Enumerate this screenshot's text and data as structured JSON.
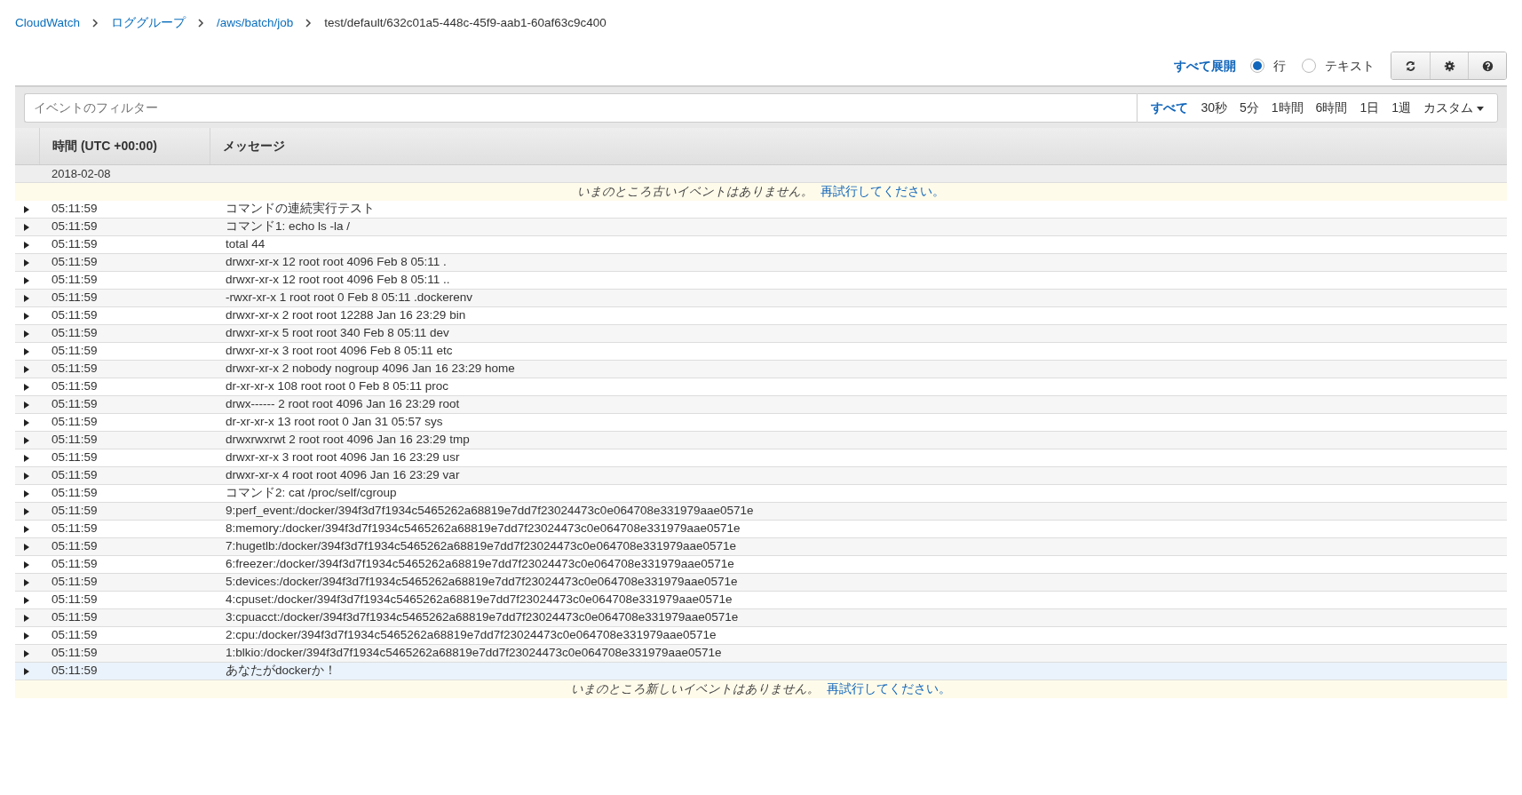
{
  "breadcrumb": [
    {
      "label": "CloudWatch",
      "link": true
    },
    {
      "label": "ロググループ",
      "link": true
    },
    {
      "label": "/aws/batch/job",
      "link": true
    },
    {
      "label": "test/default/632c01a5-448c-45f9-aab1-60af63c9c400",
      "link": false
    }
  ],
  "toolbar": {
    "expand_all": "すべて展開",
    "view_modes": [
      {
        "label": "行",
        "selected": true
      },
      {
        "label": "テキスト",
        "selected": false
      }
    ]
  },
  "filter": {
    "placeholder": "イベントのフィルター",
    "ranges": [
      {
        "label": "すべて",
        "selected": true
      },
      {
        "label": "30秒",
        "selected": false
      },
      {
        "label": "5分",
        "selected": false
      },
      {
        "label": "1時間",
        "selected": false
      },
      {
        "label": "6時間",
        "selected": false
      },
      {
        "label": "1日",
        "selected": false
      },
      {
        "label": "1週",
        "selected": false
      },
      {
        "label": "カスタム",
        "selected": false
      }
    ]
  },
  "table": {
    "columns": [
      "時間 (UTC +00:00)",
      "メッセージ"
    ],
    "date": "2018-02-08",
    "top_notice": {
      "text": "いまのところ古いイベントはありません。",
      "link": "再試行してください。"
    },
    "rows": [
      {
        "time": "05:11:59",
        "message": "コマンドの連続実行テスト",
        "selected": false
      },
      {
        "time": "05:11:59",
        "message": "コマンド1: echo ls -la /",
        "selected": false
      },
      {
        "time": "05:11:59",
        "message": "total 44",
        "selected": false
      },
      {
        "time": "05:11:59",
        "message": "drwxr-xr-x 12 root root 4096 Feb 8 05:11 .",
        "selected": false
      },
      {
        "time": "05:11:59",
        "message": "drwxr-xr-x 12 root root 4096 Feb 8 05:11 ..",
        "selected": false
      },
      {
        "time": "05:11:59",
        "message": "-rwxr-xr-x 1 root root 0 Feb 8 05:11 .dockerenv",
        "selected": false
      },
      {
        "time": "05:11:59",
        "message": "drwxr-xr-x 2 root root 12288 Jan 16 23:29 bin",
        "selected": false
      },
      {
        "time": "05:11:59",
        "message": "drwxr-xr-x 5 root root 340 Feb 8 05:11 dev",
        "selected": false
      },
      {
        "time": "05:11:59",
        "message": "drwxr-xr-x 3 root root 4096 Feb 8 05:11 etc",
        "selected": false
      },
      {
        "time": "05:11:59",
        "message": "drwxr-xr-x 2 nobody nogroup 4096 Jan 16 23:29 home",
        "selected": false
      },
      {
        "time": "05:11:59",
        "message": "dr-xr-xr-x 108 root root 0 Feb 8 05:11 proc",
        "selected": false
      },
      {
        "time": "05:11:59",
        "message": "drwx------ 2 root root 4096 Jan 16 23:29 root",
        "selected": false
      },
      {
        "time": "05:11:59",
        "message": "dr-xr-xr-x 13 root root 0 Jan 31 05:57 sys",
        "selected": false
      },
      {
        "time": "05:11:59",
        "message": "drwxrwxrwt 2 root root 4096 Jan 16 23:29 tmp",
        "selected": false
      },
      {
        "time": "05:11:59",
        "message": "drwxr-xr-x 3 root root 4096 Jan 16 23:29 usr",
        "selected": false
      },
      {
        "time": "05:11:59",
        "message": "drwxr-xr-x 4 root root 4096 Jan 16 23:29 var",
        "selected": false
      },
      {
        "time": "05:11:59",
        "message": "コマンド2: cat /proc/self/cgroup",
        "selected": false
      },
      {
        "time": "05:11:59",
        "message": "9:perf_event:/docker/394f3d7f1934c5465262a68819e7dd7f23024473c0e064708e331979aae0571e",
        "selected": false
      },
      {
        "time": "05:11:59",
        "message": "8:memory:/docker/394f3d7f1934c5465262a68819e7dd7f23024473c0e064708e331979aae0571e",
        "selected": false
      },
      {
        "time": "05:11:59",
        "message": "7:hugetlb:/docker/394f3d7f1934c5465262a68819e7dd7f23024473c0e064708e331979aae0571e",
        "selected": false
      },
      {
        "time": "05:11:59",
        "message": "6:freezer:/docker/394f3d7f1934c5465262a68819e7dd7f23024473c0e064708e331979aae0571e",
        "selected": false
      },
      {
        "time": "05:11:59",
        "message": "5:devices:/docker/394f3d7f1934c5465262a68819e7dd7f23024473c0e064708e331979aae0571e",
        "selected": false
      },
      {
        "time": "05:11:59",
        "message": "4:cpuset:/docker/394f3d7f1934c5465262a68819e7dd7f23024473c0e064708e331979aae0571e",
        "selected": false
      },
      {
        "time": "05:11:59",
        "message": "3:cpuacct:/docker/394f3d7f1934c5465262a68819e7dd7f23024473c0e064708e331979aae0571e",
        "selected": false
      },
      {
        "time": "05:11:59",
        "message": "2:cpu:/docker/394f3d7f1934c5465262a68819e7dd7f23024473c0e064708e331979aae0571e",
        "selected": false
      },
      {
        "time": "05:11:59",
        "message": "1:blkio:/docker/394f3d7f1934c5465262a68819e7dd7f23024473c0e064708e331979aae0571e",
        "selected": false
      },
      {
        "time": "05:11:59",
        "message": "あなたがdockerか！",
        "selected": true
      }
    ],
    "bottom_notice": {
      "text": "いまのところ新しいイベントはありません。",
      "link": "再試行してください。"
    }
  }
}
